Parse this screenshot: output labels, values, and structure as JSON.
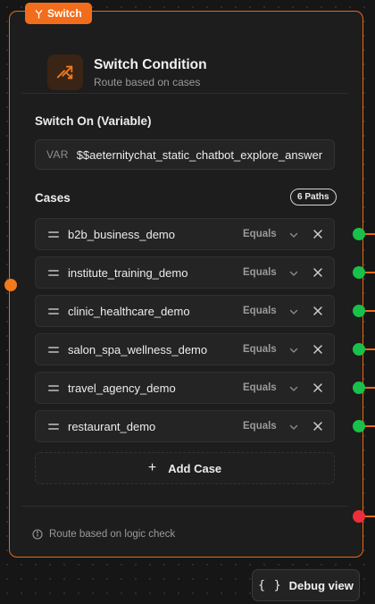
{
  "node": {
    "tab_label": "Switch",
    "title": "Switch Condition",
    "subtitle": "Route based on cases"
  },
  "switch_on": {
    "label": "Switch On (Variable)",
    "prefix": "VAR",
    "value": "$$aeternitychat_static_chatbot_explore_answer"
  },
  "cases": {
    "label": "Cases",
    "paths_badge": "6 Paths",
    "items": [
      {
        "name": "b2b_business_demo",
        "operator": "Equals"
      },
      {
        "name": "institute_training_demo",
        "operator": "Equals"
      },
      {
        "name": "clinic_healthcare_demo",
        "operator": "Equals"
      },
      {
        "name": "salon_spa_wellness_demo",
        "operator": "Equals"
      },
      {
        "name": "travel_agency_demo",
        "operator": "Equals"
      },
      {
        "name": "restaurant_demo",
        "operator": "Equals"
      }
    ],
    "add_label": "Add Case"
  },
  "footer": {
    "text": "Route based on logic check"
  },
  "debug": {
    "braces": "{ }",
    "label": "Debug view"
  },
  "colors": {
    "accent": "#f26d1b",
    "case_handle": "#19c14a",
    "default_handle": "#ec2f3a"
  }
}
